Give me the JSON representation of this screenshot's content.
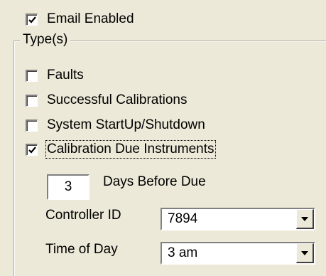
{
  "email_enabled": {
    "label": "Email Enabled",
    "checked": true
  },
  "types_group": {
    "legend": "Type(s)",
    "options": [
      {
        "label": "Faults",
        "checked": false
      },
      {
        "label": "Successful Calibrations",
        "checked": false
      },
      {
        "label": "System StartUp/Shutdown",
        "checked": false
      },
      {
        "label": "Calibration Due Instruments",
        "checked": true
      }
    ]
  },
  "days_before_due": {
    "value": "3",
    "label": "Days Before Due"
  },
  "controller_id": {
    "label": "Controller ID",
    "value": "7894"
  },
  "time_of_day": {
    "label": "Time of Day",
    "value": "3 am"
  },
  "icons": {
    "check": "checkmark-icon",
    "dropdown": "chevron-down-icon"
  }
}
